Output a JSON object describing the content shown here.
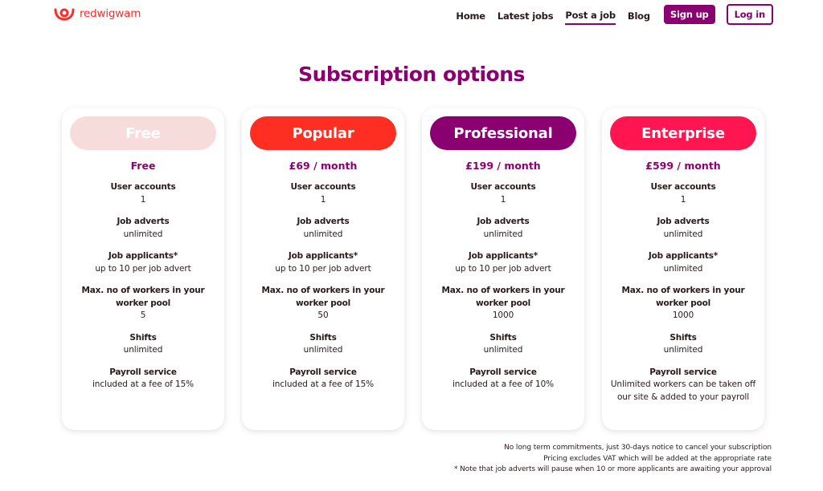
{
  "header": {
    "logo_text": "redwigwam",
    "nav": [
      {
        "label": "Home",
        "active": false
      },
      {
        "label": "Latest jobs",
        "active": false
      },
      {
        "label": "Post a job",
        "active": true
      },
      {
        "label": "Blog",
        "active": false
      }
    ],
    "signup_label": "Sign up",
    "login_label": "Log in"
  },
  "page_title": "Subscription options",
  "colors": {
    "brand_purple": "#8b0070",
    "logo_red": "#ff2a2a",
    "free": "#f7dcdc",
    "popular": "#ff2e22",
    "professional": "#8b0070",
    "enterprise": "#ff1650"
  },
  "plans": [
    {
      "name": "Free",
      "price": "Free",
      "features": [
        {
          "label": "User accounts",
          "value": "1"
        },
        {
          "label": "Job adverts",
          "value": "unlimited"
        },
        {
          "label": "Job applicants*",
          "value": "up to 10 per job advert"
        },
        {
          "label": "Max. no of workers in your worker pool",
          "value": "5"
        },
        {
          "label": "Shifts",
          "value": "unlimited"
        },
        {
          "label": "Payroll service",
          "value": "included at a fee of 15%"
        }
      ]
    },
    {
      "name": "Popular",
      "price": "£69 / month",
      "features": [
        {
          "label": "User accounts",
          "value": "1"
        },
        {
          "label": "Job adverts",
          "value": "unlimited"
        },
        {
          "label": "Job applicants*",
          "value": "up to 10 per job advert"
        },
        {
          "label": "Max. no of workers in your worker pool",
          "value": "50"
        },
        {
          "label": "Shifts",
          "value": "unlimited"
        },
        {
          "label": "Payroll service",
          "value": "included at a fee of 15%"
        }
      ]
    },
    {
      "name": "Professional",
      "price": "£199 / month",
      "features": [
        {
          "label": "User accounts",
          "value": "1"
        },
        {
          "label": "Job adverts",
          "value": "unlimited"
        },
        {
          "label": "Job applicants*",
          "value": "up to 10 per job advert"
        },
        {
          "label": "Max. no of workers in your worker pool",
          "value": "1000"
        },
        {
          "label": "Shifts",
          "value": "unlimited"
        },
        {
          "label": "Payroll service",
          "value": "included at a fee of 10%"
        }
      ]
    },
    {
      "name": "Enterprise",
      "price": "£599 / month",
      "features": [
        {
          "label": "User accounts",
          "value": "1"
        },
        {
          "label": "Job adverts",
          "value": "unlimited"
        },
        {
          "label": "Job applicants*",
          "value": "unlimited"
        },
        {
          "label": "Max. no of workers in your worker pool",
          "value": "1000"
        },
        {
          "label": "Shifts",
          "value": "unlimited"
        },
        {
          "label": "Payroll service",
          "value": "Unlimited workers can be taken off our site & added to your payroll"
        }
      ]
    }
  ],
  "notes": [
    "No long term commitments, just 30-days notice to cancel your subscription",
    "Pricing excludes VAT which will be added at the appropriate rate",
    "* Note that job adverts will pause when 10 or more applicants are awaiting your approval"
  ]
}
